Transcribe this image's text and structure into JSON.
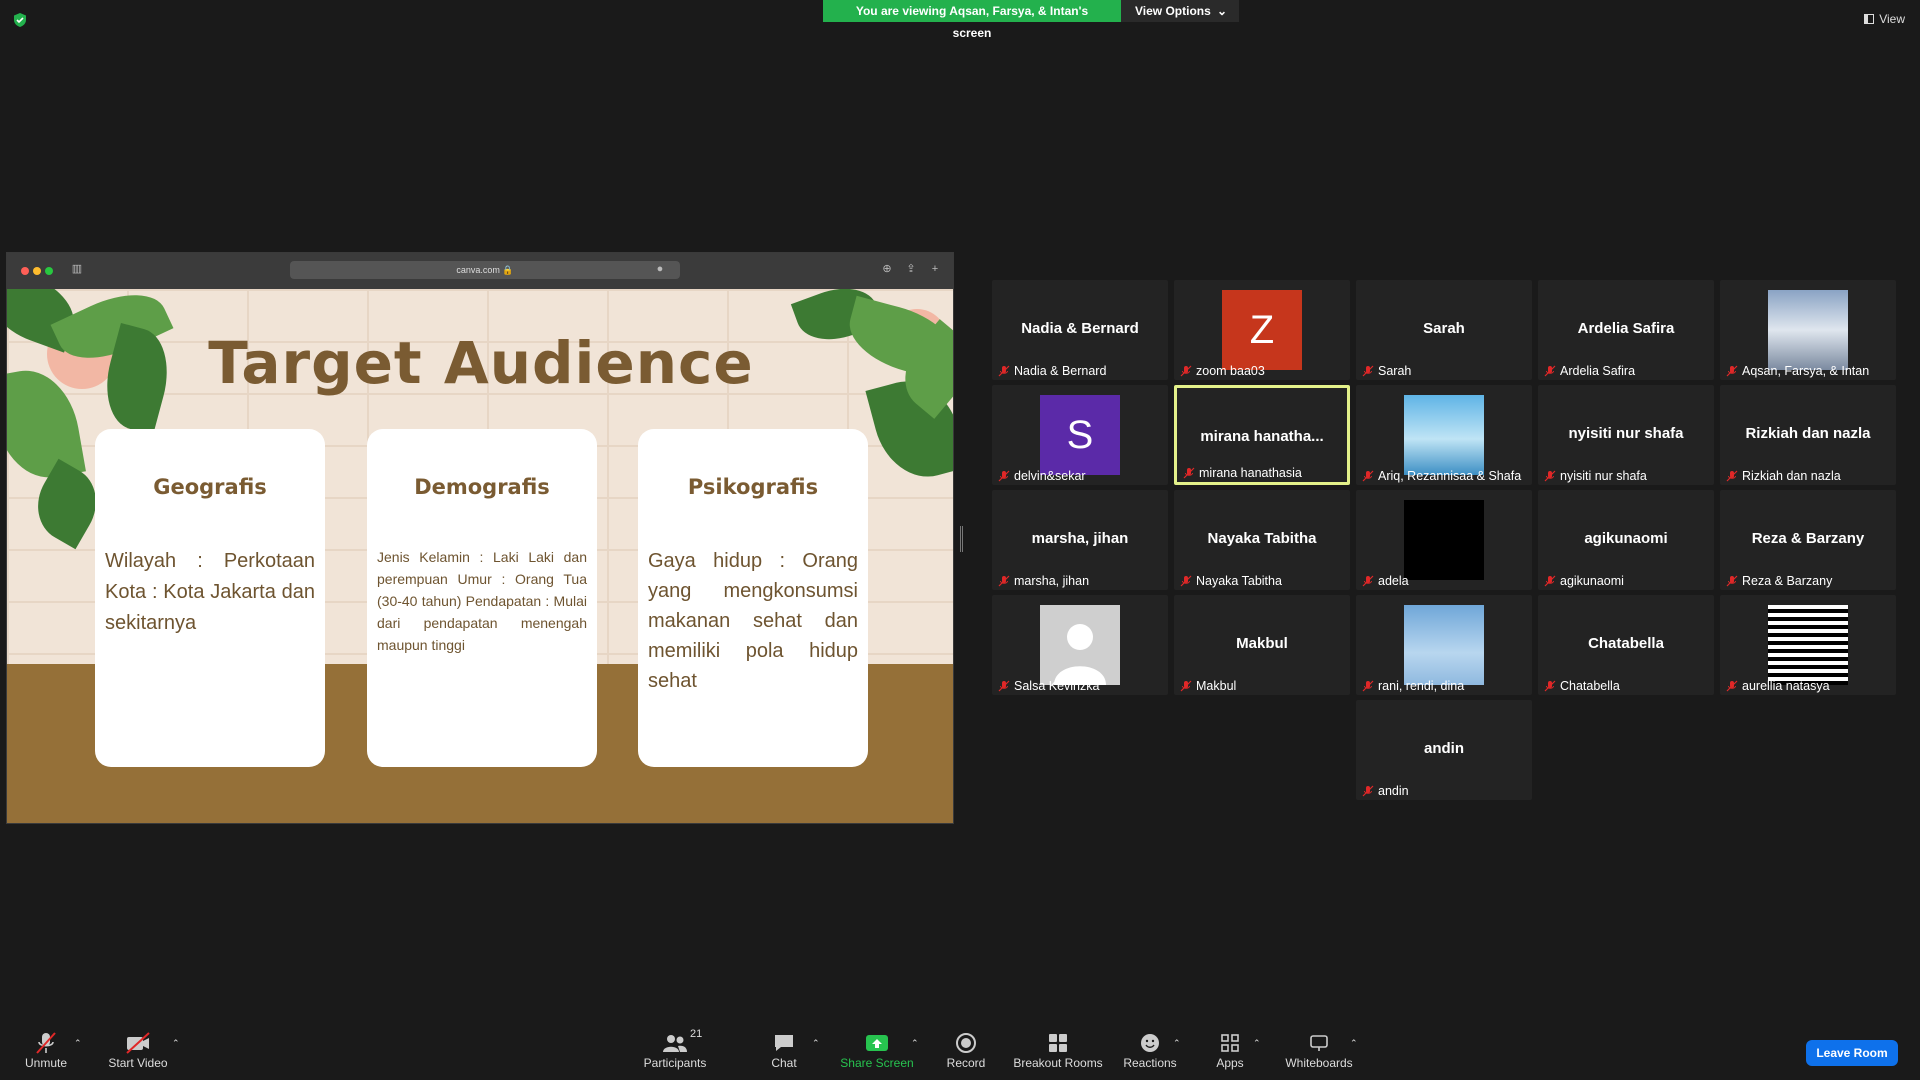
{
  "banner": {
    "viewing": "You are viewing Aqsan, Farsya, & Intan's screen",
    "view_options": "View Options"
  },
  "view_button": "View",
  "browser": {
    "url": "canva.com"
  },
  "slide": {
    "title": "Target Audience",
    "cards": [
      {
        "heading": "Geografis",
        "body": "Wilayah : Perkotaan Kota : Kota Jakarta dan sekitarnya"
      },
      {
        "heading": "Demografis",
        "body": "Jenis Kelamin : Laki Laki dan perempuan Umur : Orang Tua (30-40 tahun) Pendapatan : Mulai dari pendapatan menengah maupun tinggi"
      },
      {
        "heading": "Psikografis",
        "body": "Gaya hidup : Orang yang mengkonsumsi makanan sehat dan memiliki pola hidup sehat"
      }
    ]
  },
  "gallery": [
    {
      "name": "Nadia & Bernard",
      "label": "Nadia & Bernard"
    },
    {
      "name": "",
      "label": "zoom baa03",
      "avatar": "Z",
      "avatar_color": "#c6361c"
    },
    {
      "name": "Sarah",
      "label": "Sarah"
    },
    {
      "name": "Ardelia Safira",
      "label": "Ardelia Safira"
    },
    {
      "name": "",
      "label": "Aqsan, Farsya, & Intan",
      "pic": "goose-photo"
    },
    {
      "name": "",
      "label": "delvin&sekar",
      "avatar": "S",
      "avatar_color": "#5b2aa8"
    },
    {
      "name": "mirana  hanatha...",
      "label": "mirana hanathasia"
    },
    {
      "name": "",
      "label": "Ariq, Rezannisaa & Shafa",
      "pic": "mountain-illustration"
    },
    {
      "name": "nyisiti nur shafa",
      "label": "nyisiti nur shafa"
    },
    {
      "name": "Rizkiah dan nazla",
      "label": "Rizkiah dan nazla"
    },
    {
      "name": "marsha, jihan",
      "label": "marsha, jihan"
    },
    {
      "name": "Nayaka Tabitha",
      "label": "Nayaka Tabitha"
    },
    {
      "name": "",
      "label": "adela",
      "pic": "black-square"
    },
    {
      "name": "agikunaomi",
      "label": "agikunaomi"
    },
    {
      "name": "Reza & Barzany",
      "label": "Reza & Barzany"
    },
    {
      "name": "",
      "label": "Salsa Kevinzka",
      "pic": "default-avatar"
    },
    {
      "name": "Makbul",
      "label": "Makbul"
    },
    {
      "name": "",
      "label": "rani, rendi, dina",
      "pic": "sky-photo"
    },
    {
      "name": "Chatabella",
      "label": "Chatabella"
    },
    {
      "name": "",
      "label": "aurellia natasya",
      "pic": "stripes-image"
    },
    {
      "name": "andin",
      "label": "andin"
    }
  ],
  "toolbar": {
    "unmute": "Unmute",
    "start_video": "Start Video",
    "participants": "Participants",
    "participants_count": "21",
    "chat": "Chat",
    "share_screen": "Share Screen",
    "record": "Record",
    "breakout_rooms": "Breakout Rooms",
    "reactions": "Reactions",
    "apps": "Apps",
    "whiteboards": "Whiteboards",
    "leave": "Leave Room"
  },
  "colors": {
    "share_green": "#27c34f",
    "leave_blue": "#0e71eb",
    "active_speaker": "#e3f08a"
  }
}
